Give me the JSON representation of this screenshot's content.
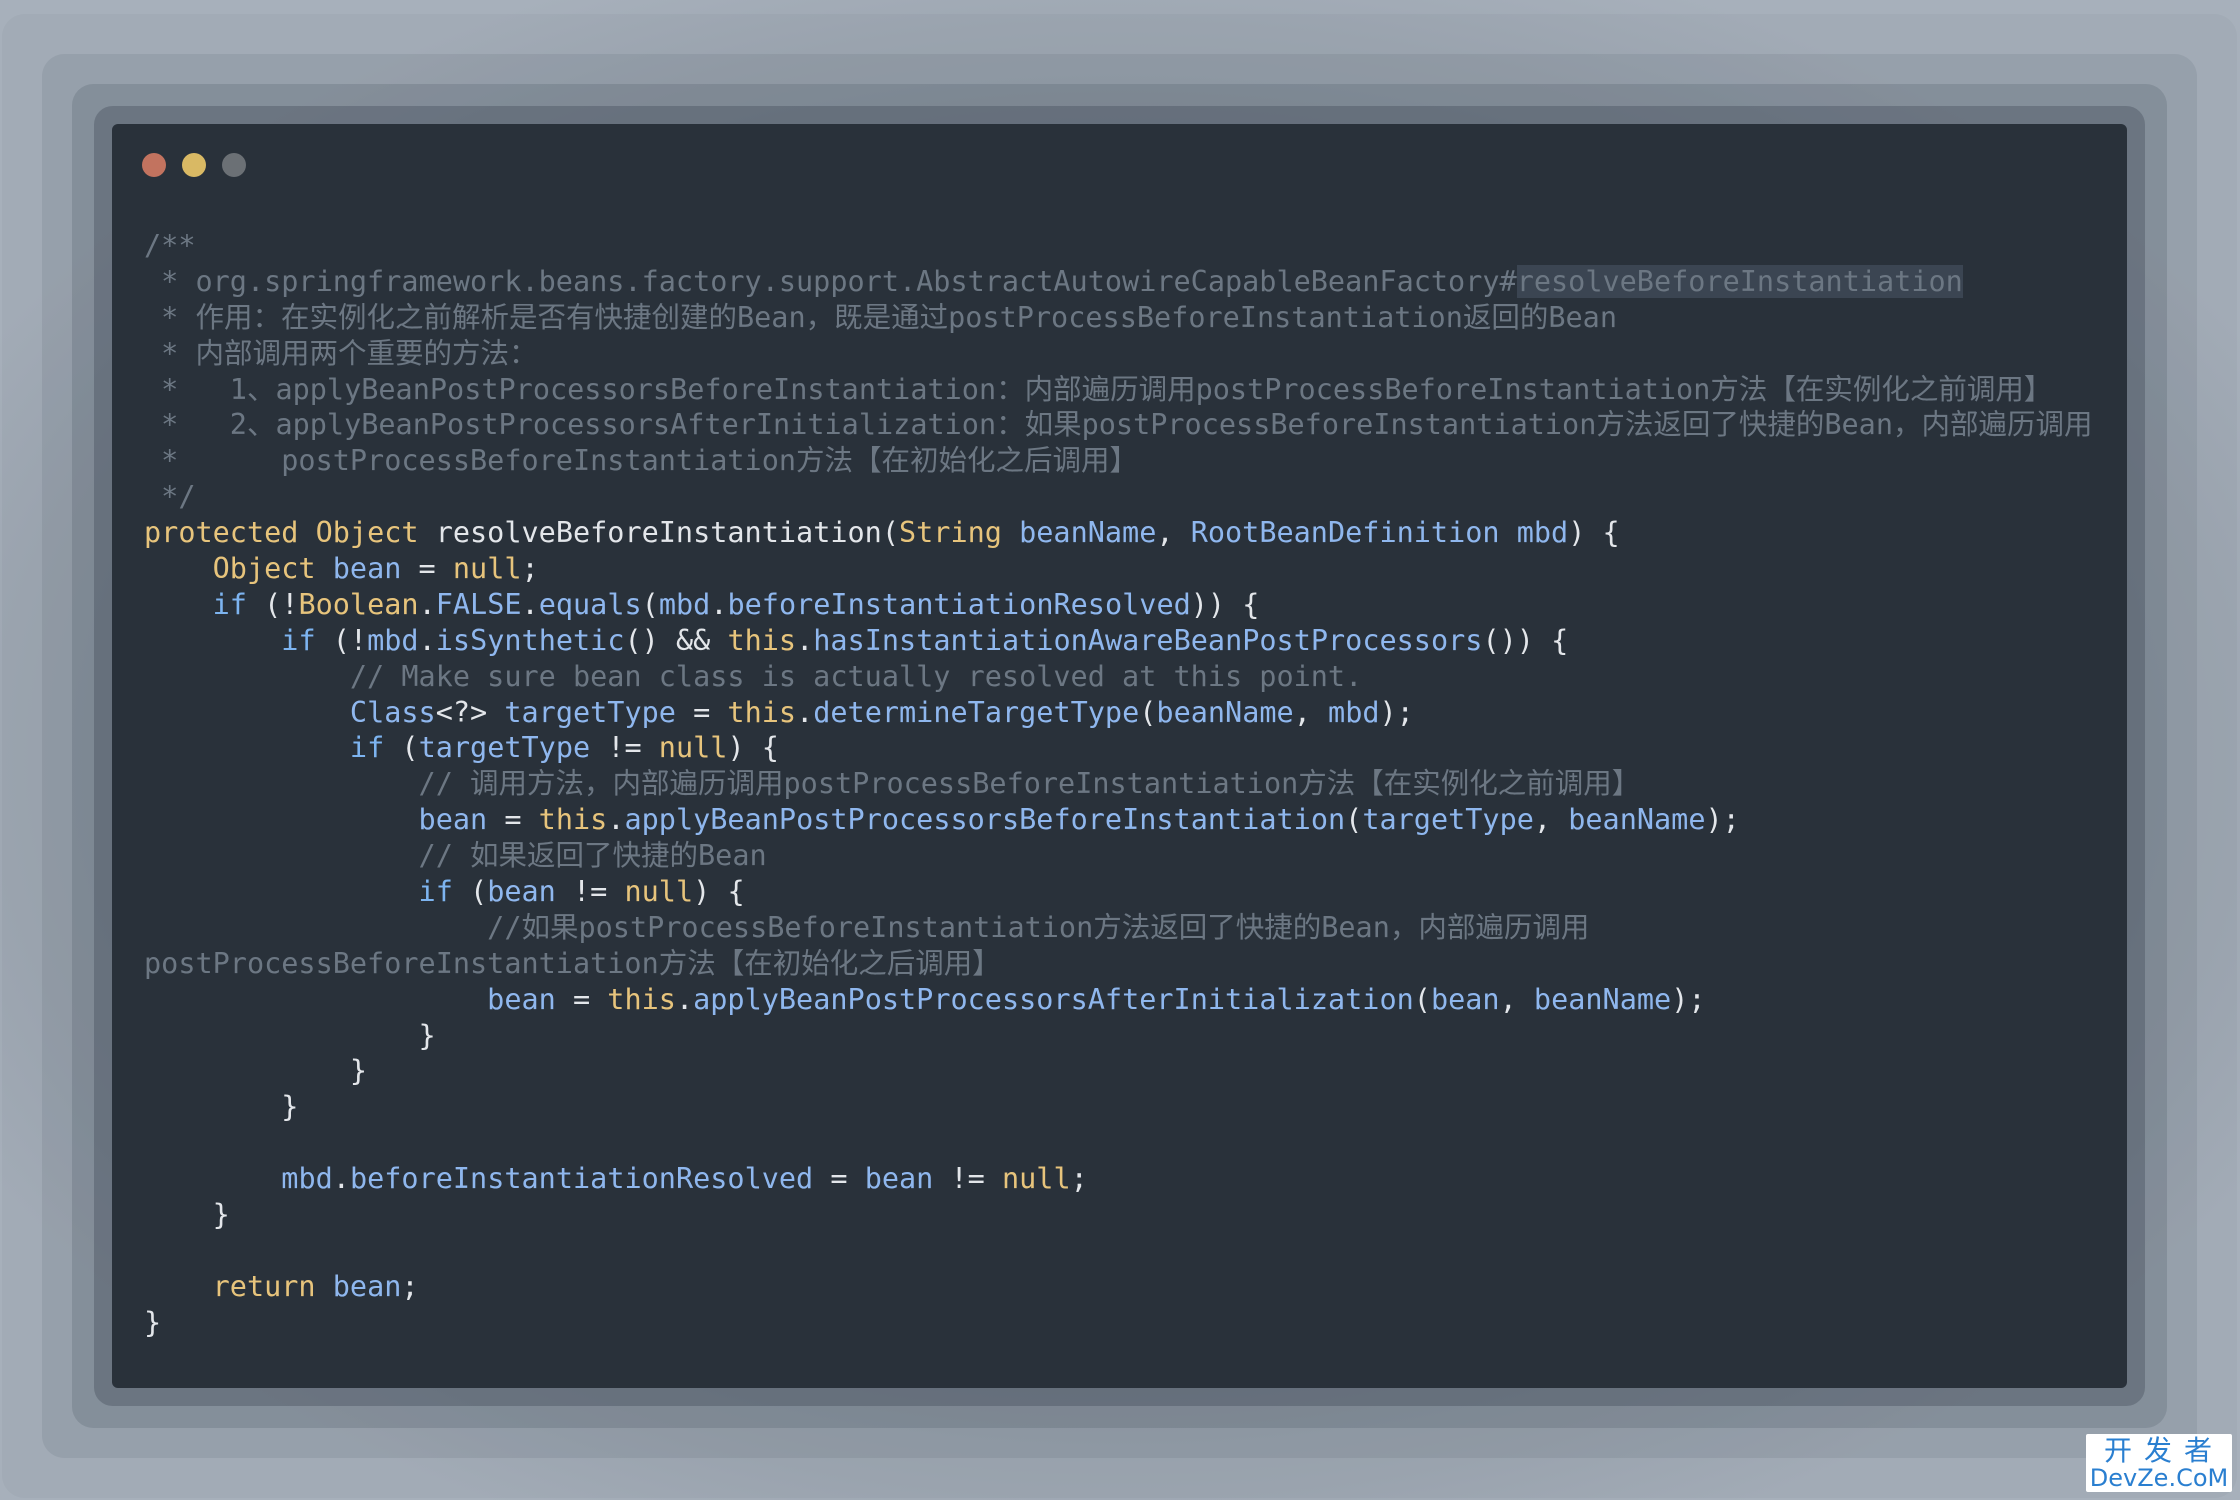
{
  "window": {
    "controls": [
      "close",
      "minimize",
      "zoom"
    ]
  },
  "code_lines": [
    [
      {
        "t": "/**",
        "c": "comment"
      }
    ],
    [
      {
        "t": " * org.springframework.beans.factory.support.AbstractAutowireCapableBeanFactory#",
        "c": "comment"
      },
      {
        "t": "resolveBeforeInstantiation",
        "c": "comment hl"
      }
    ],
    [
      {
        "t": " * 作用：在实例化之前解析是否有快捷创建的Bean，既是通过postProcessBeforeInstantiation返回的Bean",
        "c": "comment"
      }
    ],
    [
      {
        "t": " * 内部调用两个重要的方法：",
        "c": "comment"
      }
    ],
    [
      {
        "t": " *   1、applyBeanPostProcessorsBeforeInstantiation：内部遍历调用postProcessBeforeInstantiation方法【在实例化之前调用】",
        "c": "comment"
      }
    ],
    [
      {
        "t": " *   2、applyBeanPostProcessorsAfterInitialization：如果postProcessBeforeInstantiation方法返回了快捷的Bean，内部遍历调用",
        "c": "comment"
      }
    ],
    [
      {
        "t": " *      postProcessBeforeInstantiation方法【在初始化之后调用】",
        "c": "comment"
      }
    ],
    [
      {
        "t": " */",
        "c": "comment"
      }
    ],
    [
      {
        "t": "protected ",
        "c": "type"
      },
      {
        "t": "Object",
        "c": "type"
      },
      {
        "t": " resolveBeforeInstantiation(",
        "c": "plain"
      },
      {
        "t": "String",
        "c": "type"
      },
      {
        "t": " beanName",
        "c": "var"
      },
      {
        "t": ", ",
        "c": "punct"
      },
      {
        "t": "RootBeanDefinition",
        "c": "var"
      },
      {
        "t": " mbd",
        "c": "var"
      },
      {
        "t": ") {",
        "c": "punct"
      }
    ],
    [
      {
        "t": "    ",
        "c": "plain"
      },
      {
        "t": "Object",
        "c": "type"
      },
      {
        "t": " bean",
        "c": "var"
      },
      {
        "t": " = ",
        "c": "punct"
      },
      {
        "t": "null",
        "c": "type"
      },
      {
        "t": ";",
        "c": "punct"
      }
    ],
    [
      {
        "t": "    ",
        "c": "plain"
      },
      {
        "t": "if",
        "c": "kw"
      },
      {
        "t": " (!",
        "c": "punct"
      },
      {
        "t": "Boolean",
        "c": "type"
      },
      {
        "t": ".",
        "c": "punct"
      },
      {
        "t": "FALSE",
        "c": "var"
      },
      {
        "t": ".",
        "c": "punct"
      },
      {
        "t": "equals",
        "c": "fn"
      },
      {
        "t": "(",
        "c": "punct"
      },
      {
        "t": "mbd",
        "c": "var"
      },
      {
        "t": ".",
        "c": "punct"
      },
      {
        "t": "beforeInstantiationResolved",
        "c": "var"
      },
      {
        "t": ")) {",
        "c": "punct"
      }
    ],
    [
      {
        "t": "        ",
        "c": "plain"
      },
      {
        "t": "if",
        "c": "kw"
      },
      {
        "t": " (!",
        "c": "punct"
      },
      {
        "t": "mbd",
        "c": "var"
      },
      {
        "t": ".",
        "c": "punct"
      },
      {
        "t": "isSynthetic",
        "c": "fn"
      },
      {
        "t": "() && ",
        "c": "punct"
      },
      {
        "t": "this",
        "c": "type"
      },
      {
        "t": ".",
        "c": "punct"
      },
      {
        "t": "hasInstantiationAwareBeanPostProcessors",
        "c": "fn"
      },
      {
        "t": "()) {",
        "c": "punct"
      }
    ],
    [
      {
        "t": "            // Make sure bean class is actually resolved at this point.",
        "c": "comment"
      }
    ],
    [
      {
        "t": "            ",
        "c": "plain"
      },
      {
        "t": "Class",
        "c": "var"
      },
      {
        "t": "<?> ",
        "c": "punct"
      },
      {
        "t": "targetType",
        "c": "var"
      },
      {
        "t": " = ",
        "c": "punct"
      },
      {
        "t": "this",
        "c": "type"
      },
      {
        "t": ".",
        "c": "punct"
      },
      {
        "t": "determineTargetType",
        "c": "fn"
      },
      {
        "t": "(",
        "c": "punct"
      },
      {
        "t": "beanName",
        "c": "var"
      },
      {
        "t": ", ",
        "c": "punct"
      },
      {
        "t": "mbd",
        "c": "var"
      },
      {
        "t": ");",
        "c": "punct"
      }
    ],
    [
      {
        "t": "            ",
        "c": "plain"
      },
      {
        "t": "if",
        "c": "kw"
      },
      {
        "t": " (",
        "c": "punct"
      },
      {
        "t": "targetType",
        "c": "var"
      },
      {
        "t": " != ",
        "c": "punct"
      },
      {
        "t": "null",
        "c": "type"
      },
      {
        "t": ") {",
        "c": "punct"
      }
    ],
    [
      {
        "t": "                // 调用方法，内部遍历调用postProcessBeforeInstantiation方法【在实例化之前调用】",
        "c": "comment"
      }
    ],
    [
      {
        "t": "                ",
        "c": "plain"
      },
      {
        "t": "bean",
        "c": "var"
      },
      {
        "t": " = ",
        "c": "punct"
      },
      {
        "t": "this",
        "c": "type"
      },
      {
        "t": ".",
        "c": "punct"
      },
      {
        "t": "applyBeanPostProcessorsBeforeInstantiation",
        "c": "fn"
      },
      {
        "t": "(",
        "c": "punct"
      },
      {
        "t": "targetType",
        "c": "var"
      },
      {
        "t": ", ",
        "c": "punct"
      },
      {
        "t": "beanName",
        "c": "var"
      },
      {
        "t": ");",
        "c": "punct"
      }
    ],
    [
      {
        "t": "                // 如果返回了快捷的Bean",
        "c": "comment"
      }
    ],
    [
      {
        "t": "                ",
        "c": "plain"
      },
      {
        "t": "if",
        "c": "kw"
      },
      {
        "t": " (",
        "c": "punct"
      },
      {
        "t": "bean",
        "c": "var"
      },
      {
        "t": " != ",
        "c": "punct"
      },
      {
        "t": "null",
        "c": "type"
      },
      {
        "t": ") {",
        "c": "punct"
      }
    ],
    [
      {
        "t": "                    //如果postProcessBeforeInstantiation方法返回了快捷的Bean，内部遍历调用",
        "c": "comment"
      }
    ],
    [
      {
        "t": "postProcessBeforeInstantiation方法【在初始化之后调用】",
        "c": "comment"
      }
    ],
    [
      {
        "t": "                    ",
        "c": "plain"
      },
      {
        "t": "bean",
        "c": "var"
      },
      {
        "t": " = ",
        "c": "punct"
      },
      {
        "t": "this",
        "c": "type"
      },
      {
        "t": ".",
        "c": "punct"
      },
      {
        "t": "applyBeanPostProcessorsAfterInitialization",
        "c": "fn"
      },
      {
        "t": "(",
        "c": "punct"
      },
      {
        "t": "bean",
        "c": "var"
      },
      {
        "t": ", ",
        "c": "punct"
      },
      {
        "t": "beanName",
        "c": "var"
      },
      {
        "t": ");",
        "c": "punct"
      }
    ],
    [
      {
        "t": "                }",
        "c": "punct"
      }
    ],
    [
      {
        "t": "            }",
        "c": "punct"
      }
    ],
    [
      {
        "t": "        }",
        "c": "punct"
      }
    ],
    [
      {
        "t": "",
        "c": "plain"
      }
    ],
    [
      {
        "t": "        ",
        "c": "plain"
      },
      {
        "t": "mbd",
        "c": "var"
      },
      {
        "t": ".",
        "c": "punct"
      },
      {
        "t": "beforeInstantiationResolved",
        "c": "var"
      },
      {
        "t": " = ",
        "c": "punct"
      },
      {
        "t": "bean",
        "c": "var"
      },
      {
        "t": " != ",
        "c": "punct"
      },
      {
        "t": "null",
        "c": "type"
      },
      {
        "t": ";",
        "c": "punct"
      }
    ],
    [
      {
        "t": "    }",
        "c": "punct"
      }
    ],
    [
      {
        "t": "",
        "c": "plain"
      }
    ],
    [
      {
        "t": "    ",
        "c": "plain"
      },
      {
        "t": "return",
        "c": "type"
      },
      {
        "t": " bean",
        "c": "var"
      },
      {
        "t": ";",
        "c": "punct"
      }
    ],
    [
      {
        "t": "}",
        "c": "punct"
      }
    ]
  ],
  "watermark": {
    "top": "开发者",
    "bottom": "DevZe.CoM"
  }
}
